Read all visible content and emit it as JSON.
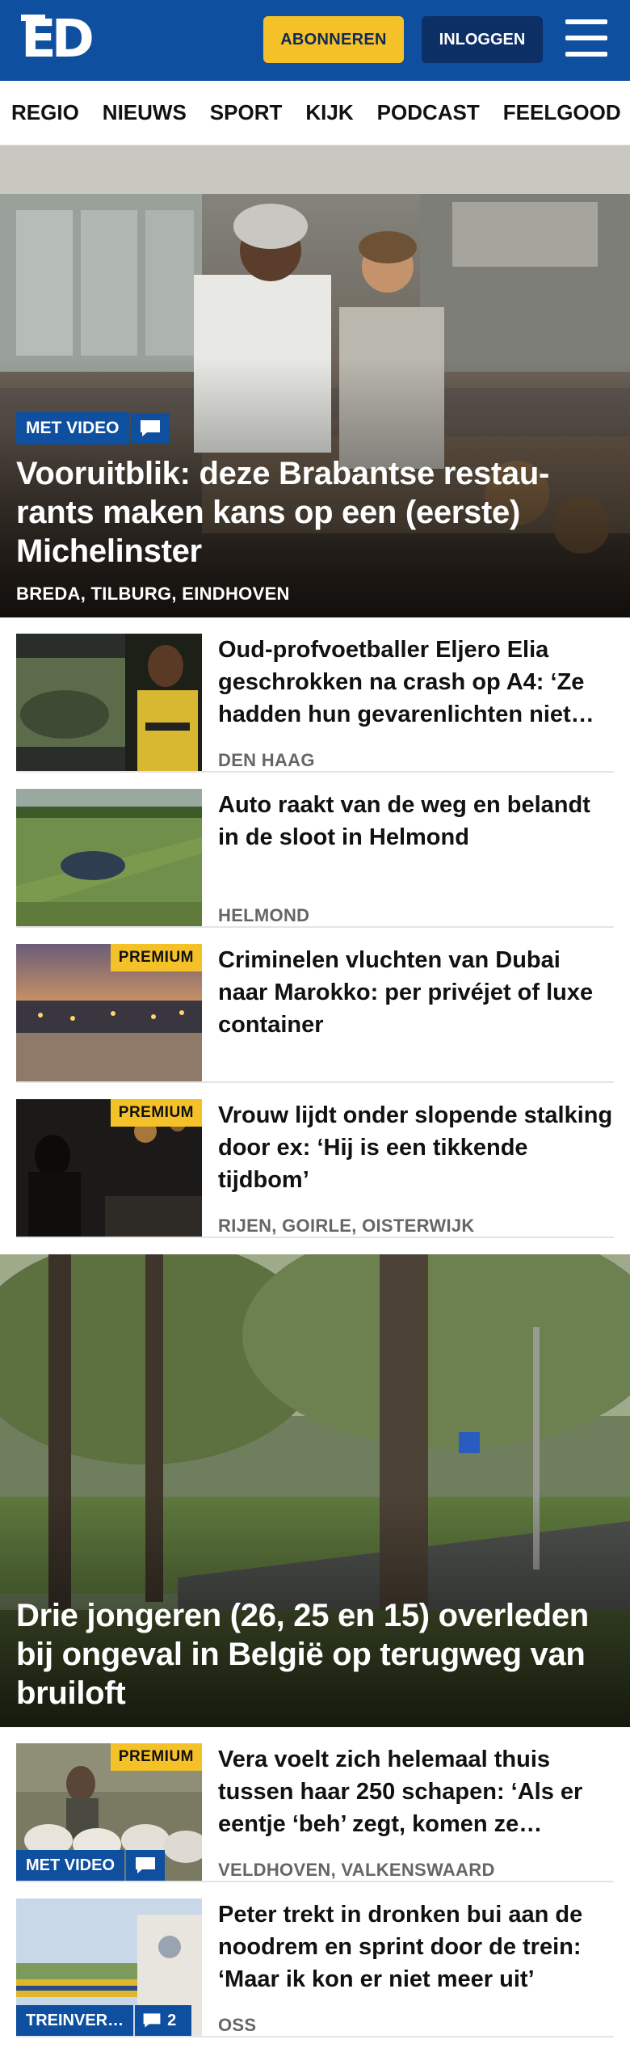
{
  "header": {
    "logo": "ED",
    "subscribe_label": "ABONNEREN",
    "login_label": "INLOGGEN"
  },
  "nav": {
    "items": [
      "REGIO",
      "NIEUWS",
      "SPORT",
      "KIJK",
      "PODCAST",
      "FEELGOOD"
    ]
  },
  "hero": {
    "badge": "MET VIDEO",
    "title": "Vooruitblik: deze Brabantse restau-rants maken kans op een (eerste) Michelinster",
    "location": "BREDA, TILBURG, EINDHOVEN"
  },
  "articles": [
    {
      "title": "Oud-profvoetballer Eljero Elia geschrokken na crash op A4: ‘Ze hadden hun gevarenlichten niet…",
      "location": "DEN HAAG"
    },
    {
      "title": "Auto raakt van de weg en belandt in de sloot in Helmond",
      "location": "HELMOND"
    },
    {
      "title": "Criminelen vluchten van Dubai naar Marokko: per privéjet of luxe container",
      "location": "",
      "premium": "PREMIUM"
    },
    {
      "title": "Vrouw lijdt onder slopende stalking door ex: ‘Hij is een tikkende tijdbom’",
      "location": "RIJEN, GOIRLE, OISTERWIJK",
      "premium": "PREMIUM"
    }
  ],
  "hero2": {
    "title": "Drie jongeren (26, 25 en 15) overleden bij ongeval in België op terugweg van bruiloft"
  },
  "articles2": [
    {
      "title": "Vera voelt zich helemaal thuis tussen haar 250 schapen: ‘Als er eentje ‘beh’ zegt, komen ze…",
      "location": "VELDHOVEN, VALKENSWAARD",
      "premium": "PREMIUM",
      "badge": "MET VIDEO"
    },
    {
      "title": "Peter trekt in dronken bui aan de noodrem en sprint door de trein: ‘Maar ik kon er niet meer uit’",
      "location": "OSS",
      "badge": "TREINVER…",
      "comments": "2"
    }
  ],
  "colors": {
    "brand_blue": "#0f4f9f",
    "accent_yellow": "#f5c128",
    "dark_blue": "#0c2f66"
  }
}
